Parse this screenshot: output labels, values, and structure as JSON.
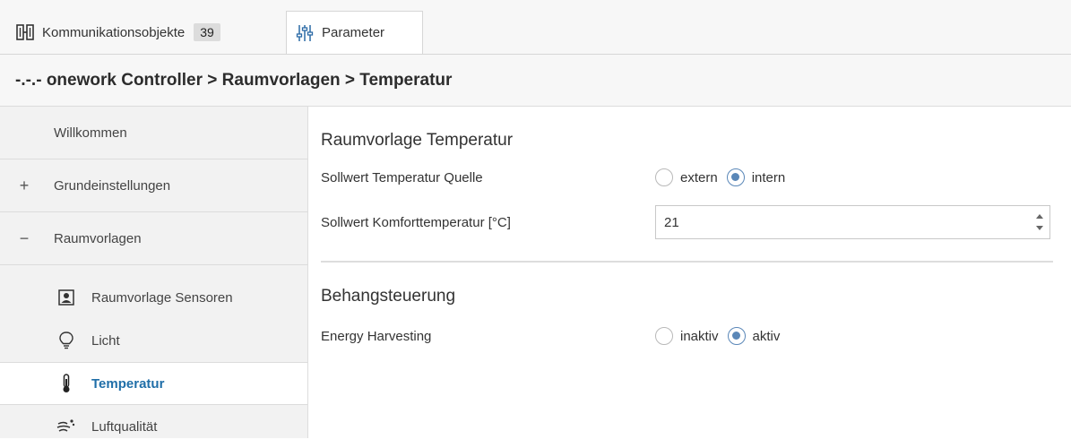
{
  "tabs": {
    "objects": {
      "label": "Kommunikationsobjekte",
      "count": "39",
      "icon": "communication-objects-icon"
    },
    "parameters": {
      "label": "Parameter",
      "icon": "sliders-icon",
      "active": true
    }
  },
  "breadcrumb": "-.-.- onework Controller > Raumvorlagen > Temperatur",
  "sidebar": {
    "items": [
      {
        "label": "Willkommen",
        "symbol": ""
      },
      {
        "label": "Grundeinstellungen",
        "symbol": "+"
      },
      {
        "label": "Raumvorlagen",
        "symbol": "−"
      }
    ],
    "subitems": [
      {
        "label": "Raumvorlage Sensoren",
        "icon": "sensor-icon"
      },
      {
        "label": "Licht",
        "icon": "light-bulb-icon"
      },
      {
        "label": "Temperatur",
        "icon": "thermometer-icon",
        "active": true
      },
      {
        "label": "Luftqualität",
        "icon": "air-quality-icon"
      }
    ]
  },
  "main": {
    "section1": {
      "title": "Raumvorlage Temperatur",
      "source": {
        "label": "Sollwert Temperatur Quelle",
        "options": [
          "extern",
          "intern"
        ],
        "selected": "intern"
      },
      "comfort": {
        "label": "Sollwert Komforttemperatur [°C]",
        "value": "21"
      }
    },
    "section2": {
      "title": "Behangsteuerung",
      "harvesting": {
        "label": "Energy Harvesting",
        "options": [
          "inaktiv",
          "aktiv"
        ],
        "selected": "aktiv"
      }
    }
  },
  "colors": {
    "accent": "#1f6ea8",
    "radio": "#5a87b8",
    "sidebar_bg": "#f2f2f2"
  }
}
